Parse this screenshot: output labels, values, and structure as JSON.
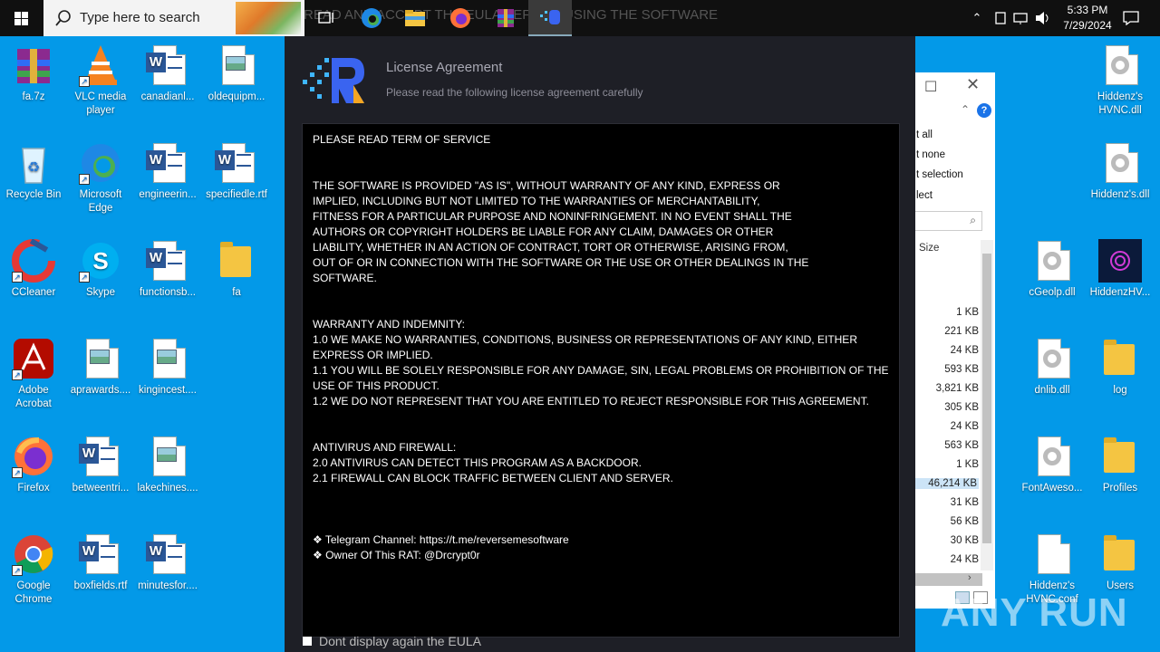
{
  "taskbar": {
    "search_placeholder": "Type here to search",
    "ghost_title": "READ AND ACCEPT THE EULA BEFORE USING THE SOFTWARE",
    "apps": [
      "task-view",
      "microsoft-edge",
      "file-explorer",
      "firefox",
      "winrar",
      "license-app"
    ],
    "clock_time": "5:33 PM",
    "clock_date": "7/29/2024"
  },
  "desktop_left": [
    {
      "label": "fa.7z",
      "icon": "winrar-archive-icon"
    },
    {
      "label": "VLC media player",
      "icon": "vlc-icon"
    },
    {
      "label": "canadianl...",
      "icon": "word-doc-icon"
    },
    {
      "label": "oldequipm...",
      "icon": "image-file-icon"
    },
    {
      "label": "Recycle Bin",
      "icon": "recycle-bin-icon"
    },
    {
      "label": "Microsoft Edge",
      "icon": "edge-icon"
    },
    {
      "label": "engineerin...",
      "icon": "word-doc-icon"
    },
    {
      "label": "specifiedle.rtf",
      "icon": "word-doc-icon"
    },
    {
      "label": "CCleaner",
      "icon": "ccleaner-icon"
    },
    {
      "label": "Skype",
      "icon": "skype-icon"
    },
    {
      "label": "functionsb...",
      "icon": "word-doc-icon"
    },
    {
      "label": "fa",
      "icon": "folder-icon"
    },
    {
      "label": "Adobe Acrobat",
      "icon": "acrobat-icon"
    },
    {
      "label": "aprawards....",
      "icon": "image-file-icon"
    },
    {
      "label": "kingincest....",
      "icon": "image-file-icon"
    },
    {
      "label": "Firefox",
      "icon": "firefox-icon"
    },
    {
      "label": "betweentri...",
      "icon": "word-doc-icon"
    },
    {
      "label": "lakechines....",
      "icon": "image-file-icon"
    },
    {
      "label": "Google Chrome",
      "icon": "chrome-icon"
    },
    {
      "label": "boxfields.rtf",
      "icon": "word-doc-icon"
    },
    {
      "label": "minutesfor....",
      "icon": "word-doc-icon"
    }
  ],
  "desktop_right": [
    {
      "label": "Hiddenz's HVNC.dll",
      "icon": "dll-gear-icon"
    },
    {
      "label": "Hiddenz's.dll",
      "icon": "dll-gear-icon"
    },
    {
      "label": "cGeolp.dll",
      "icon": "dll-gear-icon"
    },
    {
      "label": "HiddenzHV...",
      "icon": "hvnc-app-icon"
    },
    {
      "label": "dnlib.dll",
      "icon": "dll-gear-icon"
    },
    {
      "label": "log",
      "icon": "folder-icon"
    },
    {
      "label": "FontAweso...",
      "icon": "dll-gear-icon"
    },
    {
      "label": "Profiles",
      "icon": "folder-icon"
    },
    {
      "label": "Hiddenz's HVNC.conf",
      "icon": "blank-file-icon"
    },
    {
      "label": "Users",
      "icon": "folder-icon"
    }
  ],
  "explorer": {
    "menu": [
      "t all",
      "t none",
      "t selection",
      "lect"
    ],
    "size_header": "Size",
    "sizes": [
      "1 KB",
      "221 KB",
      "24 KB",
      "593 KB",
      "3,821 KB",
      "305 KB",
      "24 KB",
      "563 KB",
      "1 KB",
      "46,214 KB",
      "31 KB",
      "56 KB",
      "30 KB",
      "24 KB"
    ]
  },
  "dialog": {
    "title": "License Agreement",
    "subtitle": "Please read the following license agreement carefully",
    "terms": {
      "heading": "PLEASE READ TERM OF SERVICE",
      "as_is": "THE SOFTWARE IS PROVIDED \"AS IS\", WITHOUT WARRANTY OF ANY KIND, EXPRESS OR\nIMPLIED, INCLUDING BUT NOT LIMITED TO THE WARRANTIES OF MERCHANTABILITY,\nFITNESS FOR A PARTICULAR PURPOSE AND NONINFRINGEMENT. IN NO EVENT SHALL THE\nAUTHORS OR COPYRIGHT HOLDERS BE LIABLE FOR ANY CLAIM, DAMAGES OR OTHER\nLIABILITY, WHETHER IN AN ACTION OF CONTRACT, TORT OR OTHERWISE, ARISING FROM,\nOUT OF OR IN CONNECTION WITH THE SOFTWARE OR THE USE OR OTHER DEALINGS IN THE\nSOFTWARE.",
      "warranty": "WARRANTY AND INDEMNITY:\n1.0 WE MAKE NO WARRANTIES, CONDITIONS, BUSINESS OR REPRESENTATIONS OF ANY KIND, EITHER\nEXPRESS OR IMPLIED.\n1.1 YOU WILL BE SOLELY RESPONSIBLE FOR ANY DAMAGE, SIN, LEGAL PROBLEMS OR PROHIBITION OF THE\nUSE OF THIS PRODUCT.\n1.2 WE DO NOT REPRESENT THAT YOU ARE ENTITLED TO REJECT RESPONSIBLE FOR THIS AGREEMENT.",
      "antivirus": "ANTIVIRUS AND FIREWALL:\n2.0 ANTIVIRUS CAN DETECT THIS PROGRAM AS A BACKDOOR.\n2.1 FIREWALL CAN BLOCK TRAFFIC BETWEEN CLIENT AND SERVER.",
      "telegram": "❖ Telegram Channel: https://t.me/reversemesoftware",
      "owner": "❖ Owner Of This RAT: @Drcrypt0r"
    },
    "dont_show": "Dont display again the EULA"
  },
  "watermark": "ANY RUN",
  "colors": {
    "desktop": "#0399e8",
    "dialog_bg": "#1e1f26",
    "terms_bg": "#000000",
    "accent": "#2f6cf6"
  }
}
